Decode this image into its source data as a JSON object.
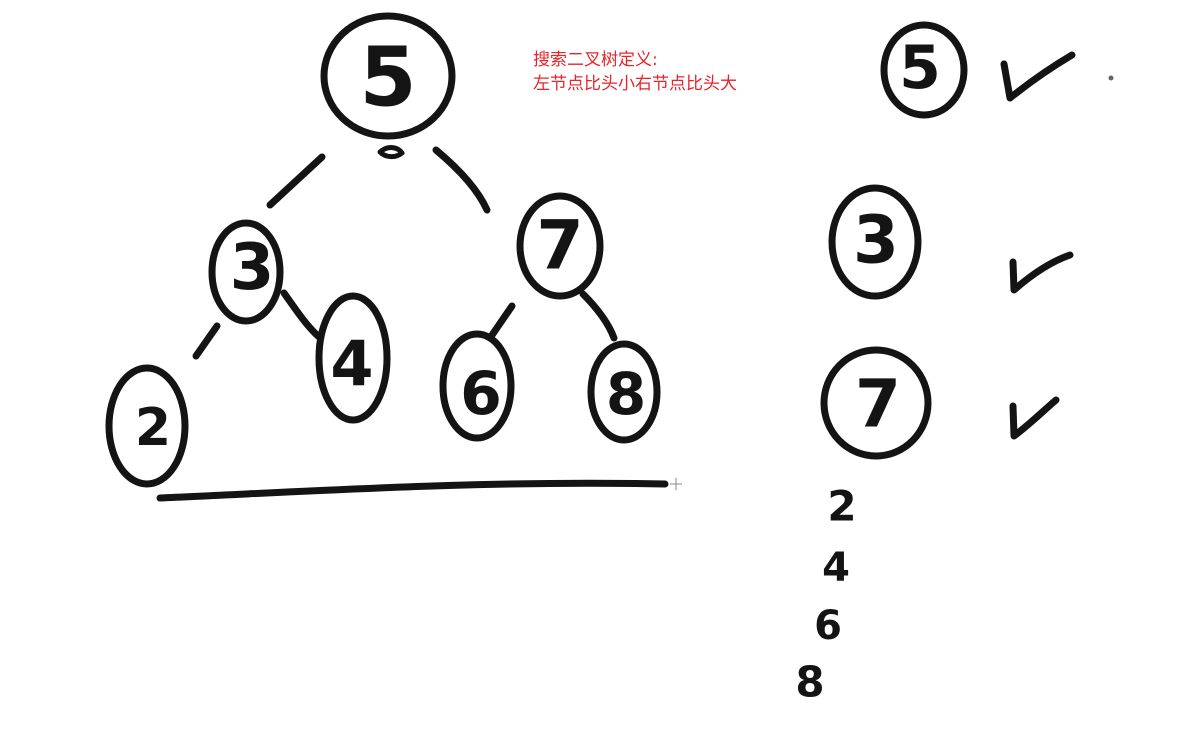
{
  "note": {
    "line1": "搜索二叉树定义:",
    "line2": "左节点比头小右节点比头大"
  },
  "tree": {
    "root": "5",
    "left": "3",
    "right": "7",
    "left_left": "2",
    "left_right": "4",
    "right_left": "6",
    "right_right": "8"
  },
  "checks": {
    "node1": "5",
    "node2": "3",
    "node3": "7",
    "mark": "✓"
  },
  "sequence": [
    "2",
    "4",
    "6",
    "8"
  ],
  "colors": {
    "ink": "#141414",
    "note": "#e8232a",
    "background": "#ffffff"
  }
}
